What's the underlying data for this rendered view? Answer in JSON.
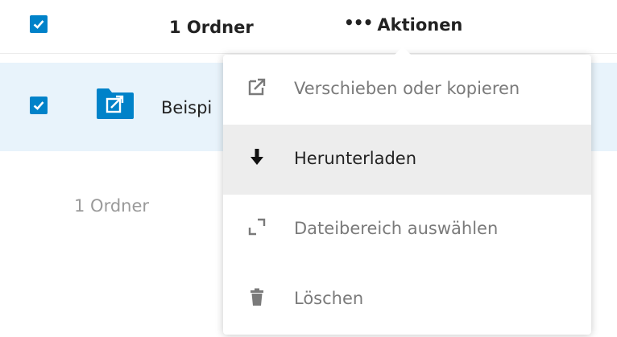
{
  "header": {
    "count_label": "1 Ordner",
    "actions_dots": "•••",
    "actions_label": "Aktionen"
  },
  "file_row": {
    "name": "Beispi",
    "selected": true
  },
  "footer": {
    "count_label": "1 Ordner"
  },
  "menu": {
    "items": [
      {
        "label": "Verschieben oder kopieren",
        "icon": "external-link-icon"
      },
      {
        "label": "Herunterladen",
        "icon": "download-arrow-icon"
      },
      {
        "label": "Dateibereich auswählen",
        "icon": "range-corner-icon"
      },
      {
        "label": "Löschen",
        "icon": "trash-icon"
      }
    ]
  },
  "colors": {
    "accent": "#0082c9",
    "selected_row": "#e8f3fb",
    "hover_item": "#ededed"
  }
}
